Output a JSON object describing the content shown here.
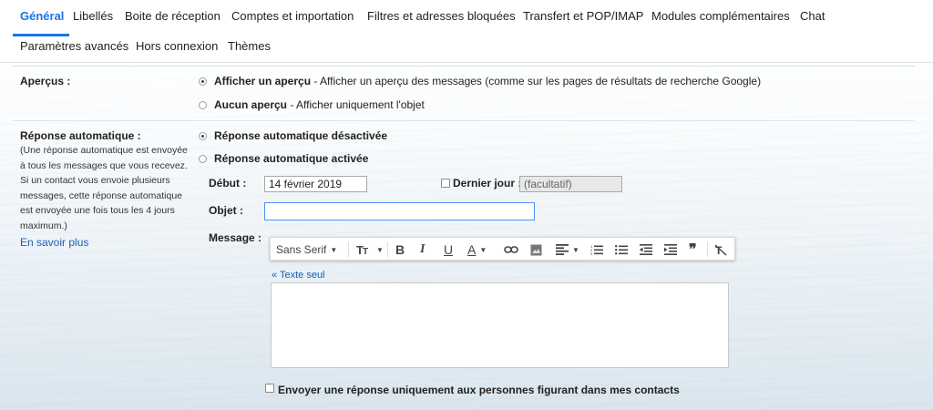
{
  "tabs": [
    {
      "label": "Général",
      "active": true
    },
    {
      "label": "Libellés"
    },
    {
      "label": "Boite de réception"
    },
    {
      "label": "Comptes et importation"
    },
    {
      "label": "Filtres et adresses bloquées"
    },
    {
      "label": "Transfert et POP/IMAP"
    },
    {
      "label": "Modules complémentaires"
    },
    {
      "label": "Chat"
    },
    {
      "label": "Paramètres avancés"
    },
    {
      "label": "Hors connexion"
    },
    {
      "label": "Thèmes"
    }
  ],
  "accent_color": "#1a73e8",
  "apercus": {
    "label": "Aperçus :",
    "options": [
      {
        "title": "Afficher un aperçu",
        "desc": " - Afficher un aperçu des messages (comme sur les pages de résultats de recherche Google)",
        "checked": true
      },
      {
        "title": "Aucun aperçu",
        "desc": " - Afficher uniquement l'objet",
        "checked": false
      }
    ]
  },
  "reponse": {
    "label": "Réponse automatique :",
    "description": "(Une réponse automatique est envoyée à tous les messages que vous recevez. Si un contact vous envoie plusieurs messages, cette réponse automatique est envoyée une fois tous les 4 jours maximum.)",
    "learn_more": "En savoir plus",
    "options": [
      {
        "title": "Réponse automatique désactivée",
        "checked": true
      },
      {
        "title": "Réponse automatique activée",
        "checked": false
      }
    ],
    "debut_label": "Début :",
    "debut_value": "14 février 2019",
    "dernier_jour_label": "Dernier jour :",
    "dernier_jour_placeholder": "(facultatif)",
    "objet_label": "Objet :",
    "objet_value": "",
    "message_label": "Message :",
    "plain_text_link": "« Texte seul",
    "contacts_only_label": "Envoyer une réponse uniquement aux personnes figurant dans mes contacts"
  },
  "toolbar": {
    "font": "Sans Serif",
    "icons": [
      "font-size-icon",
      "bold-icon",
      "italic-icon",
      "underline-icon",
      "text-color-icon",
      "link-icon",
      "image-icon",
      "align-icon",
      "numbered-list-icon",
      "bulleted-list-icon",
      "indent-less-icon",
      "indent-more-icon",
      "quote-icon",
      "remove-formatting-icon"
    ]
  }
}
